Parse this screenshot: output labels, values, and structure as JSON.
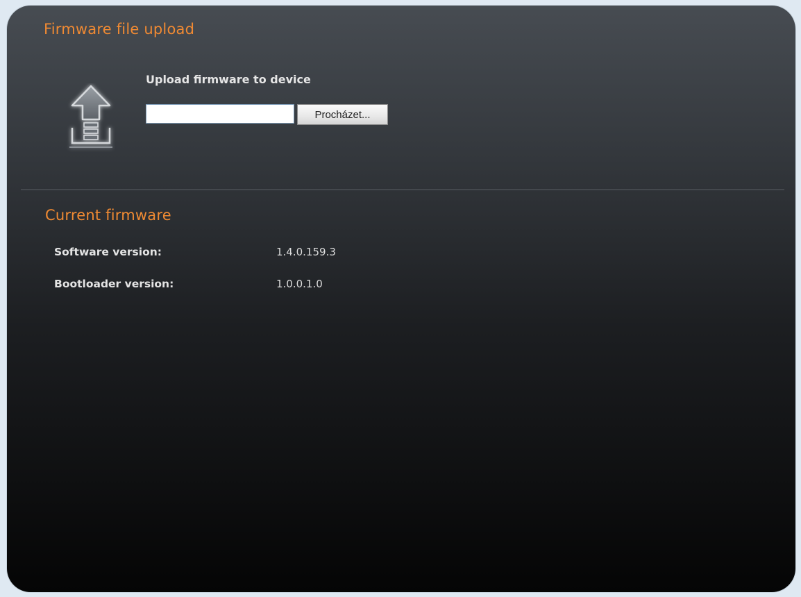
{
  "upload_section": {
    "title": "Firmware file upload",
    "label": "Upload firmware to device",
    "file_input_value": "",
    "browse_button_label": "Procházet..."
  },
  "current_section": {
    "title": "Current firmware",
    "software_label": "Software version:",
    "software_value": "1.4.0.159.3",
    "bootloader_label": "Bootloader version:",
    "bootloader_value": "1.0.0.1.0"
  },
  "colors": {
    "accent": "#f08a33",
    "panel_top": "#474c52",
    "panel_bottom": "#050505",
    "page_bg": "#dfe9f2"
  },
  "icons": {
    "upload": "upload-arrow-icon"
  }
}
